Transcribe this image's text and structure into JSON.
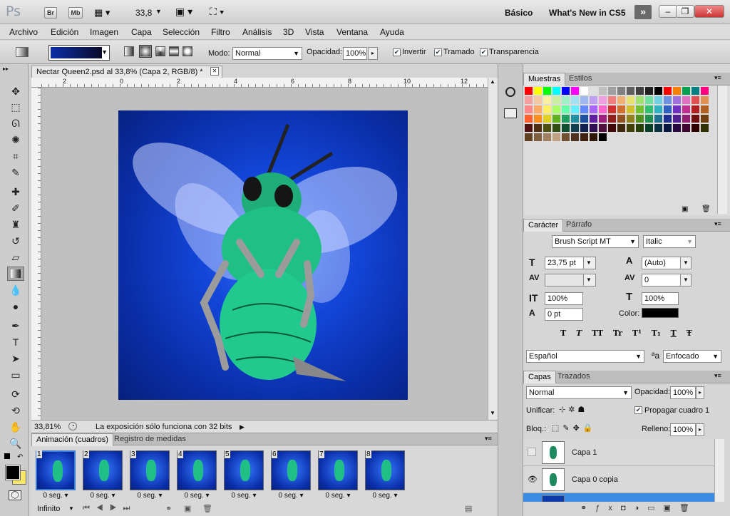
{
  "appbar": {
    "logo": "Ps",
    "bridge_label": "Br",
    "minibridge_label": "Mb",
    "zoom": "33,8",
    "workspace_basic": "Básico",
    "workspace_new": "What's New in CS5",
    "more_label": "»"
  },
  "menu": [
    "Archivo",
    "Edición",
    "Imagen",
    "Capa",
    "Selección",
    "Filtro",
    "Análisis",
    "3D",
    "Vista",
    "Ventana",
    "Ayuda"
  ],
  "options": {
    "mode_label": "Modo:",
    "mode_value": "Normal",
    "opacity_label": "Opacidad:",
    "opacity_value": "100%",
    "invert_label": "Invertir",
    "dither_label": "Tramado",
    "transparency_label": "Transparencia",
    "gradient_colors": [
      "#0b2fa8",
      "#0a0a2a"
    ]
  },
  "document": {
    "tab_title": "Nectar Queen2.psd al 33,8% (Capa 2, RGB/8) *",
    "ruler_ticks": [
      "2",
      "0",
      "2",
      "4",
      "6",
      "8",
      "10",
      "12"
    ],
    "zoom_status": "33,81%",
    "status_message": "La exposición sólo funciona con 32 bits"
  },
  "swatches_panel": {
    "tabs": [
      "Muestras",
      "Estilos"
    ],
    "colors": [
      "#ff0000",
      "#ffff00",
      "#00ff00",
      "#00ffff",
      "#0000ff",
      "#ff00ff",
      "#ffffff",
      "#e0e0e0",
      "#c0c0c0",
      "#a0a0a0",
      "#808080",
      "#606060",
      "#404040",
      "#202020",
      "#000000",
      "#ff0000",
      "#ff8000",
      "#00a050",
      "#008080",
      "#ff0080",
      "#f4a0a0",
      "#f4c8a0",
      "#f8f0a0",
      "#c8f0a0",
      "#a0f0c8",
      "#a0e0f0",
      "#a0b8f0",
      "#c0a0f0",
      "#f0a0e0",
      "#f08080",
      "#f0b070",
      "#e8e070",
      "#a0e070",
      "#70e0a0",
      "#70d0e0",
      "#7090e0",
      "#a070e0",
      "#e070c0",
      "#e05050",
      "#e09050",
      "#ff8888",
      "#ffaa66",
      "#ffee66",
      "#aaff66",
      "#66ffaa",
      "#66eeff",
      "#6688ff",
      "#aa66ff",
      "#ff66cc",
      "#d03030",
      "#d07030",
      "#d0c030",
      "#70c030",
      "#30c070",
      "#30b0c0",
      "#3060c0",
      "#7030c0",
      "#c03090",
      "#b02020",
      "#b06020",
      "#ff6030",
      "#ff9020",
      "#e0d020",
      "#60b020",
      "#20a060",
      "#2090a0",
      "#2050a0",
      "#6020a0",
      "#a02080",
      "#902020",
      "#905020",
      "#908020",
      "#509020",
      "#209050",
      "#207090",
      "#203090",
      "#502090",
      "#902070",
      "#701010",
      "#704010",
      "#501010",
      "#503010",
      "#505010",
      "#305010",
      "#105030",
      "#104050",
      "#102050",
      "#301050",
      "#501040",
      "#400808",
      "#402808",
      "#404008",
      "#284008",
      "#084028",
      "#083040",
      "#081840",
      "#280840",
      "#400830",
      "#300000",
      "#303000",
      "#604020",
      "#806040",
      "#a08060",
      "#c0a080",
      "#705030",
      "#503020",
      "#402010",
      "#301808",
      "#000000"
    ]
  },
  "character_panel": {
    "tabs": [
      "Carácter",
      "Párrafo"
    ],
    "font_family": "Brush Script MT",
    "font_style": "Italic",
    "size": "23,75 pt",
    "leading": "(Auto)",
    "kerning": "",
    "tracking": "0",
    "vscale": "100%",
    "hscale": "100%",
    "baseline": "0 pt",
    "color_label": "Color:",
    "language": "Español",
    "aa_mode": "Enfocado",
    "styles": [
      "T",
      "T",
      "TT",
      "Tr",
      "T¹",
      "T₁",
      "T",
      "Ŧ"
    ]
  },
  "layers_panel": {
    "tabs": [
      "Capas",
      "Trazados"
    ],
    "blend": "Normal",
    "opacity_label": "Opacidad:",
    "opacity": "100%",
    "unify_label": "Unificar:",
    "propagate_label": "Propagar cuadro 1",
    "lock_label": "Bloq.:",
    "fill_label": "Relleno:",
    "fill": "100%",
    "layers": [
      {
        "name": "Capa 1",
        "visible": false
      },
      {
        "name": "Capa 0 copia",
        "visible": true
      }
    ]
  },
  "animation_panel": {
    "tabs": [
      "Animación (cuadros)",
      "Registro de medidas"
    ],
    "frames": [
      {
        "num": "1",
        "delay": "0 seg."
      },
      {
        "num": "2",
        "delay": "0 seg."
      },
      {
        "num": "3",
        "delay": "0 seg."
      },
      {
        "num": "4",
        "delay": "0 seg."
      },
      {
        "num": "5",
        "delay": "0 seg."
      },
      {
        "num": "6",
        "delay": "0 seg."
      },
      {
        "num": "7",
        "delay": "0 seg."
      },
      {
        "num": "8",
        "delay": "0 seg."
      }
    ],
    "loop": "Infinito"
  }
}
